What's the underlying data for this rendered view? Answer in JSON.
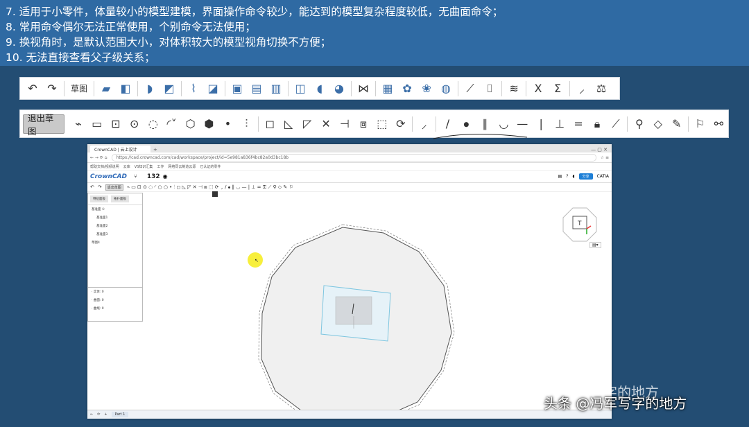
{
  "notes": [
    "7.  适用于小零件，体量较小的模型建模，界面操作命令较少，能达到的模型复杂程度较低，无曲面命令；",
    "8.  常用命令偶尔无法正常使用，个别命令无法使用；",
    "9.  换视角时，是默认范围大小，对体积较大的模型视角切换不方便；",
    "10. 无法直接查看父子级关系；"
  ],
  "toolbar1": {
    "sketch_label": "草图",
    "x_label": "X",
    "sigma_label": "Σ"
  },
  "toolbar2": {
    "exit_label": "退出草图"
  },
  "browser": {
    "tab_title": "CrownCAD | 云上设计",
    "url": "https://cad.crowncad.com/cad/workspace/project/id=5e981a836f4bc82a0d3bc18b",
    "bookmarks": [
      "帮助文档/视频说明",
      "云库",
      "VS知识汇集",
      "工作",
      "网络同云制造云源",
      "已认证的零件"
    ],
    "logo": "CrownCAD",
    "count": "132",
    "share_button": "分享",
    "user": "CATIA",
    "exit_sketch": "退出草图",
    "panel_tabs": [
      "特征面板",
      "拓扑面板"
    ],
    "tree": [
      "基准面 ①",
      "基准面1",
      "基准面2",
      "基准面3",
      "草图4"
    ],
    "stats": [
      "· 实体: 0",
      "· 曲面: 0",
      "· 曲线: 0"
    ],
    "part_tab": "Part 1",
    "cube_face": "T"
  },
  "watermark": "头条 @冯军写字的地方",
  "watermark_ghost": "冯军写字的地方"
}
